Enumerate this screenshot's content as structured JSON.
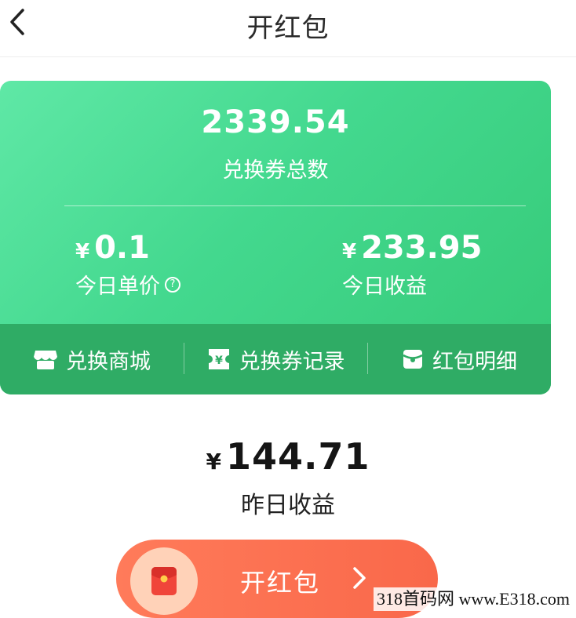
{
  "header": {
    "title": "开红包"
  },
  "card": {
    "total_value": "2339.54",
    "total_label": "兑换券总数",
    "unit_price": {
      "currency": "¥",
      "value": "0.1",
      "label": "今日单价"
    },
    "today_income": {
      "currency": "¥",
      "value": "233.95",
      "label": "今日收益"
    },
    "actions": [
      {
        "label": "兑换商城",
        "icon": "shop-icon"
      },
      {
        "label": "兑换券记录",
        "icon": "voucher-icon"
      },
      {
        "label": "红包明细",
        "icon": "red-envelope-icon"
      }
    ]
  },
  "yesterday": {
    "currency": "¥",
    "value": "144.71",
    "label": "昨日收益"
  },
  "open_button": {
    "label": "开红包"
  },
  "watermark": "318首码网 www.E318.com",
  "colors": {
    "card_gradient_start": "#5fe8a6",
    "card_gradient_end": "#35c977",
    "action_bar": "#2fac65",
    "button": "#f9684a"
  }
}
